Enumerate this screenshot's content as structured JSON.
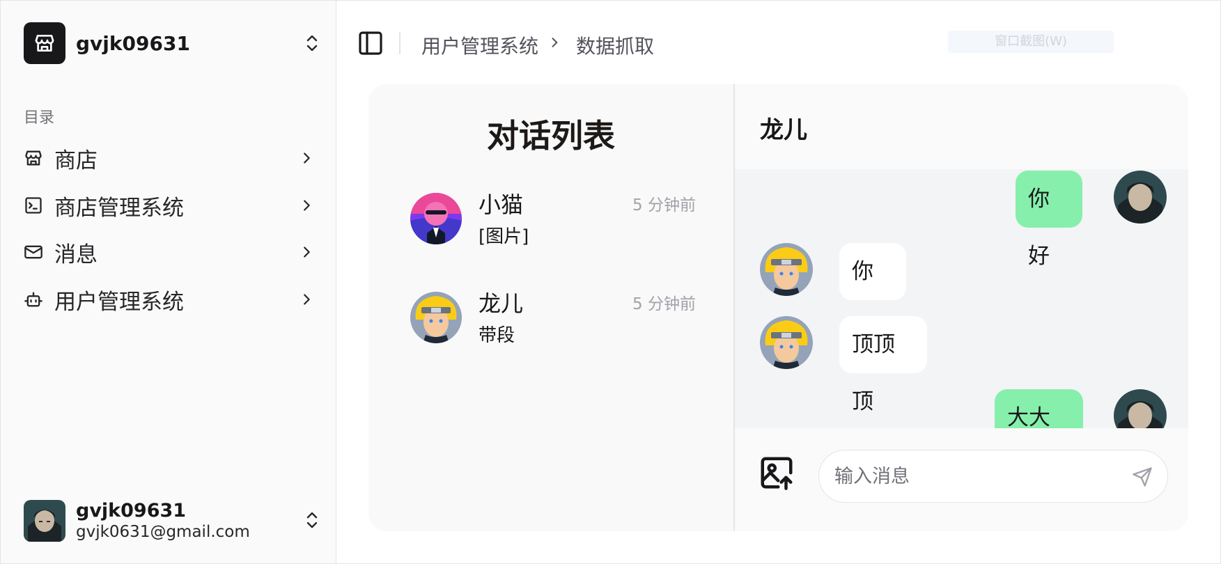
{
  "workspace": {
    "name": "gvjk09631"
  },
  "sidebar": {
    "section_label": "目录",
    "items": [
      {
        "label": "商店",
        "icon": "store-icon"
      },
      {
        "label": "商店管理系统",
        "icon": "terminal-square-icon"
      },
      {
        "label": "消息",
        "icon": "mail-icon"
      },
      {
        "label": "用户管理系统",
        "icon": "bot-icon"
      }
    ]
  },
  "user": {
    "name": "gvjk09631",
    "email": "gvjk0631@gmail.com"
  },
  "header": {
    "breadcrumb": [
      "用户管理系统",
      "数据抓取"
    ],
    "ghost_button": "窗口截图(W)"
  },
  "conversations": {
    "title": "对话列表",
    "items": [
      {
        "name": "小猫",
        "time": "5 分钟前",
        "preview": "[图片]"
      },
      {
        "name": "龙儿",
        "time": "5 分钟前",
        "preview": "带段"
      }
    ]
  },
  "chat": {
    "contact": "龙儿",
    "messages": [
      {
        "from": "me",
        "text": "你好"
      },
      {
        "from": "them",
        "text": "你好"
      },
      {
        "from": "them",
        "text": "顶顶顶"
      },
      {
        "from": "me",
        "text": "大大大"
      }
    ],
    "input_placeholder": "输入消息"
  },
  "colors": {
    "sent_bubble": "#86efac",
    "received_bubble": "#ffffff",
    "accent": "#18181b"
  }
}
